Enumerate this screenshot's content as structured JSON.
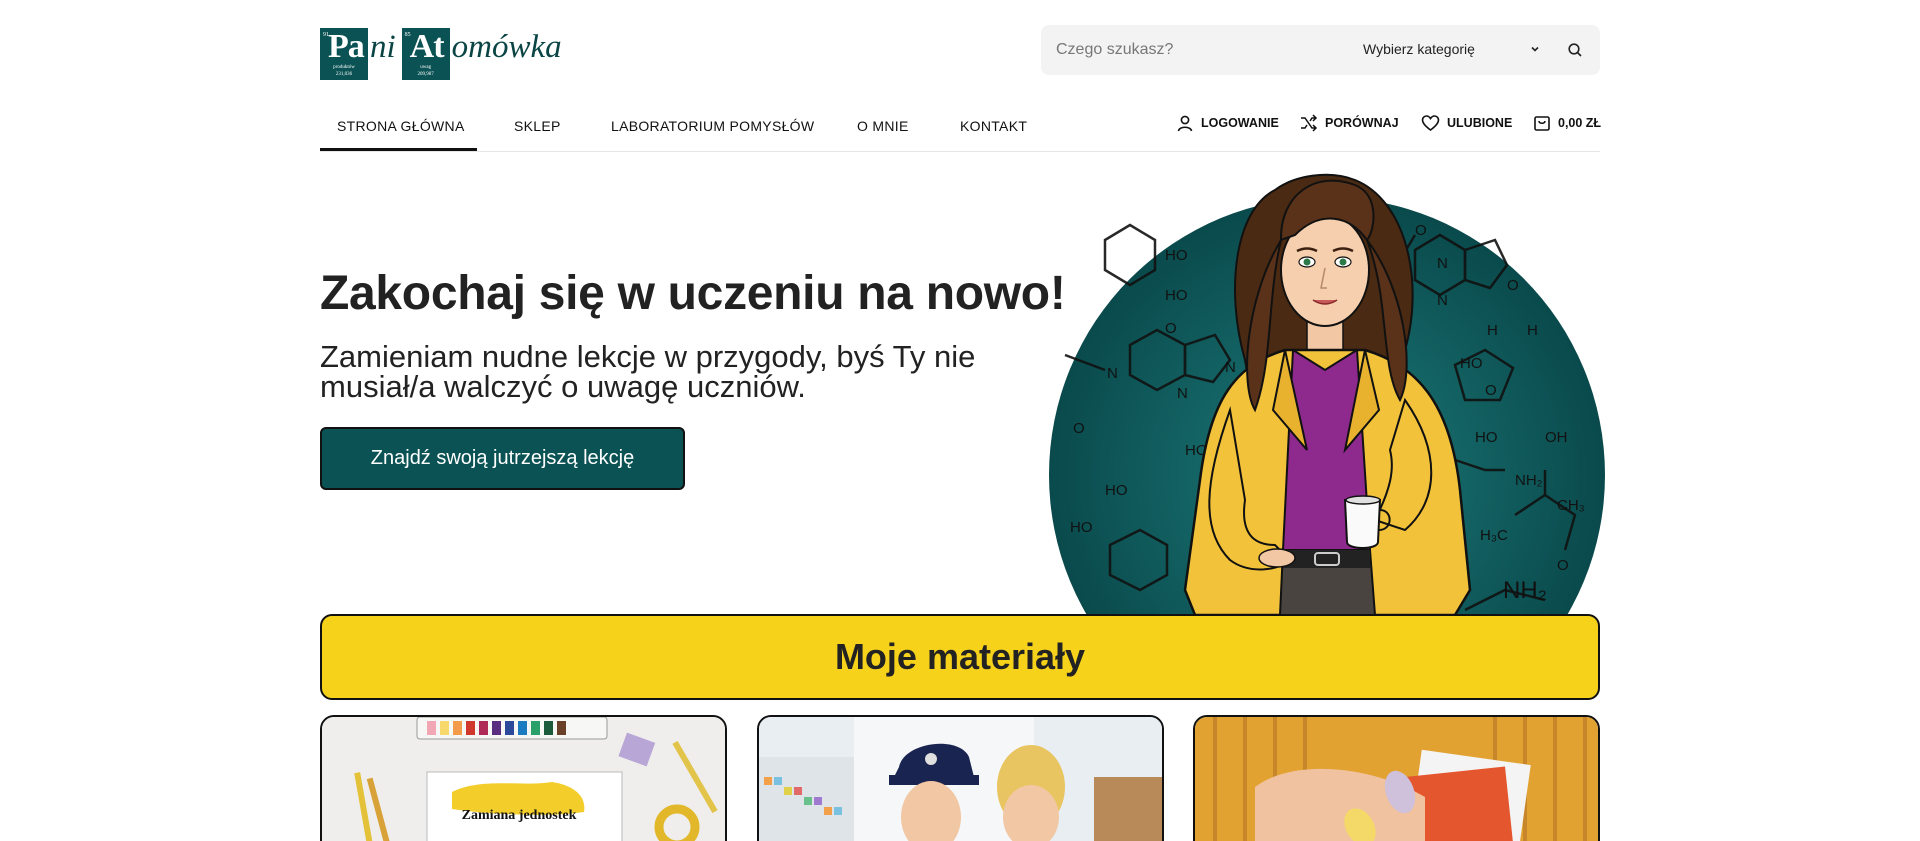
{
  "logo": {
    "tile1": {
      "symbol": "Pa",
      "number": "91",
      "line1": "produktów",
      "line2": "231,036"
    },
    "tile2": {
      "symbol": "At",
      "number": "85",
      "line1": "uwag",
      "line2": "209,987"
    },
    "script1": "ni ",
    "script2": "omówka"
  },
  "search": {
    "placeholder": "Czego szukasz?",
    "category": "Wybierz kategorię"
  },
  "nav": {
    "items": [
      "Strona Główna",
      "Sklep",
      "Laboratorium Pomysłów",
      "O mnie",
      "Kontakt"
    ]
  },
  "utility": {
    "login": "LOGOWANIE",
    "compare": "PORÓWNAJ",
    "wishlist": "ULUBIONE",
    "cart": "0,00 ZŁ"
  },
  "hero": {
    "title": "Zakochaj się w uczeniu na nowo!",
    "subtitle": "Zamieniam nudne lekcje w przygody, byś Ty nie musiał/a walczyć o uwagę uczniów.",
    "cta": "Znajdź swoją jutrzejszą lekcję"
  },
  "materials": {
    "heading": "Moje materiały"
  },
  "cards": {
    "card1_label": "Zamiana jednostek"
  },
  "colors": {
    "brand": "#0a5253",
    "accent": "#f7d21b",
    "coat": "#f2c23a",
    "shirt": "#8e2a8e"
  }
}
